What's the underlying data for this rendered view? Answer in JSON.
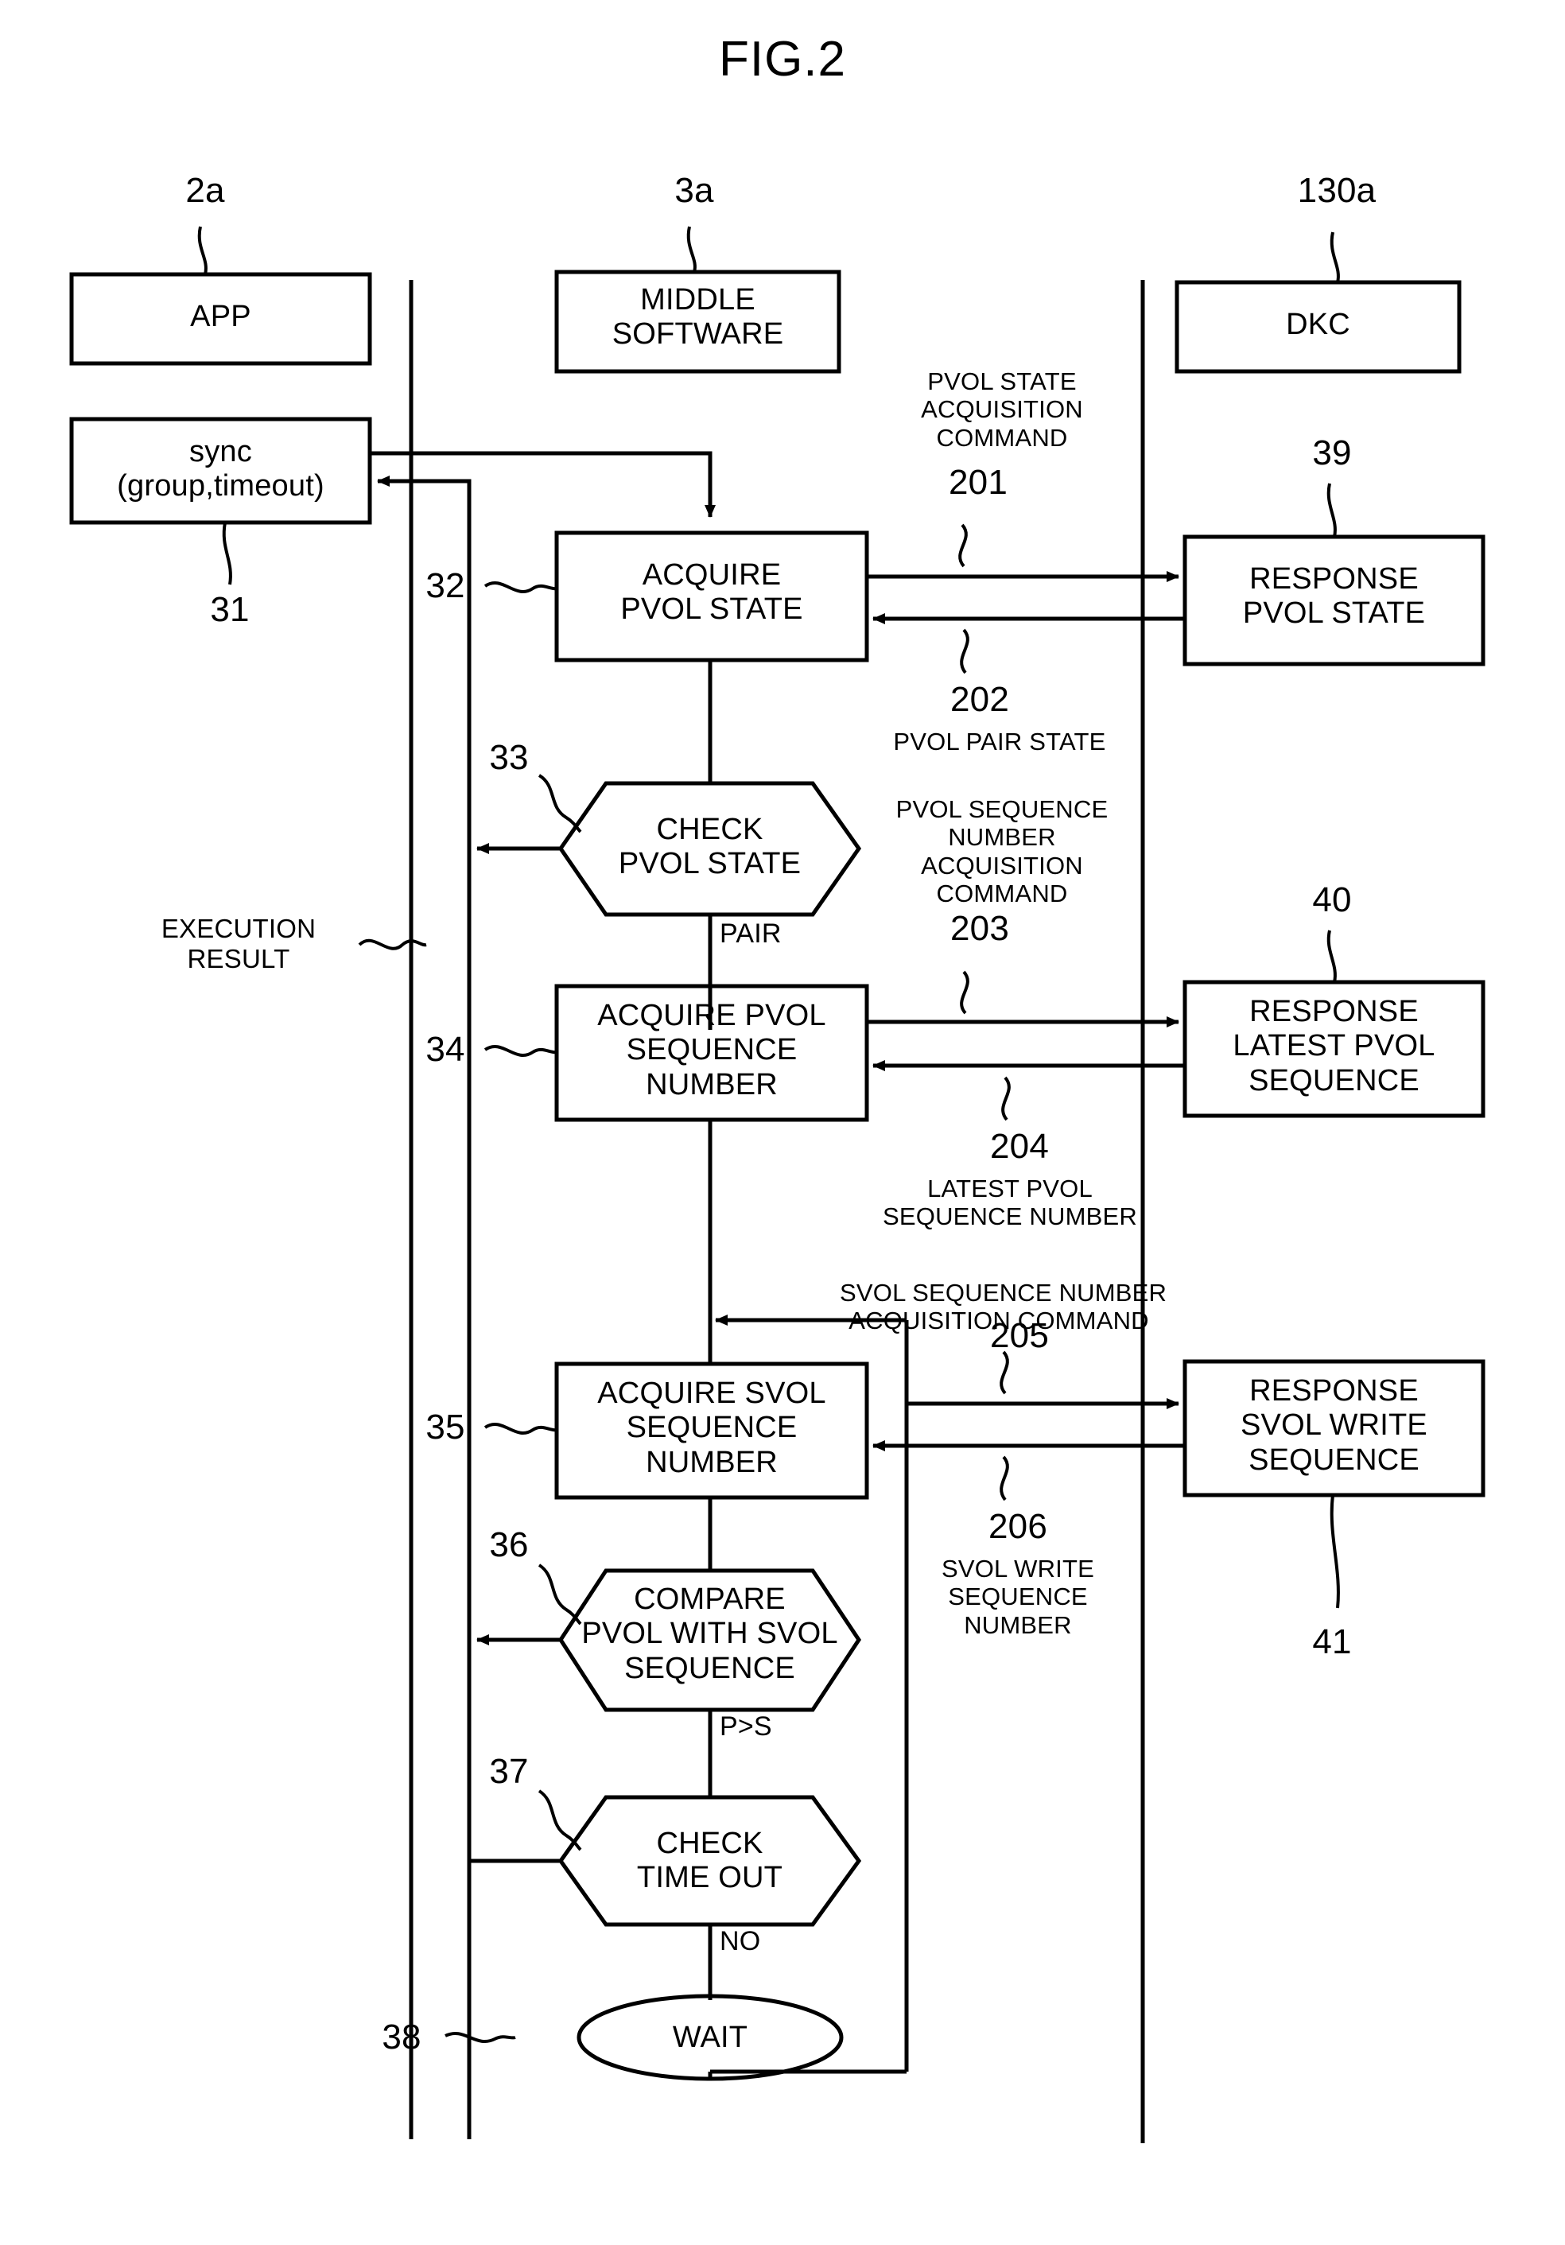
{
  "figure": {
    "title": "FIG.2",
    "type": "patent-flow-diagram"
  },
  "columns": [
    {
      "ref": "2a",
      "label": "APP"
    },
    {
      "ref": "3a",
      "label": "MIDDLE\nSOFTWARE"
    },
    {
      "ref": "130a",
      "label": "DKC"
    }
  ],
  "app_column": {
    "sync_box": {
      "ref": "31",
      "label": "sync\n(group,timeout)"
    },
    "execution_result_label": "EXECUTION\nRESULT"
  },
  "middleware_steps": [
    {
      "ref": "32",
      "shape": "rect",
      "label": "ACQUIRE\nPVOL STATE"
    },
    {
      "ref": "33",
      "shape": "hexagon",
      "label": "CHECK\nPVOL STATE",
      "exit": "PAIR"
    },
    {
      "ref": "34",
      "shape": "rect",
      "label": "ACQUIRE PVOL\nSEQUENCE\nNUMBER"
    },
    {
      "ref": "35",
      "shape": "rect",
      "label": "ACQUIRE SVOL\nSEQUENCE\nNUMBER"
    },
    {
      "ref": "36",
      "shape": "hexagon",
      "label": "COMPARE\nPVOL WITH SVOL\nSEQUENCE",
      "exit": "P>S"
    },
    {
      "ref": "37",
      "shape": "hexagon",
      "label": "CHECK\nTIME OUT",
      "exit": "NO"
    },
    {
      "ref": "38",
      "shape": "ellipse",
      "label": "WAIT"
    }
  ],
  "dkc_boxes": [
    {
      "ref": "39",
      "label": "RESPONSE\nPVOL STATE"
    },
    {
      "ref": "40",
      "label": "RESPONSE\nLATEST PVOL\nSEQUENCE"
    },
    {
      "ref": "41",
      "label": "RESPONSE\nSVOL WRITE\nSEQUENCE"
    }
  ],
  "messages": [
    {
      "ref": "201",
      "label": "PVOL STATE\nACQUISITION\nCOMMAND",
      "direction": "to-dkc"
    },
    {
      "ref": "202",
      "label": "PVOL PAIR STATE",
      "direction": "from-dkc"
    },
    {
      "ref": "203",
      "label": "PVOL SEQUENCE\nNUMBER\nACQUISITION\nCOMMAND",
      "direction": "to-dkc"
    },
    {
      "ref": "204",
      "label": "LATEST PVOL\nSEQUENCE NUMBER",
      "direction": "from-dkc"
    },
    {
      "ref": "205",
      "label": "SVOL SEQUENCE NUMBER\nACQUISITION COMMAND",
      "direction": "to-dkc"
    },
    {
      "ref": "206",
      "label": "SVOL WRITE\nSEQUENCE\nNUMBER",
      "direction": "from-dkc"
    }
  ],
  "colors": {
    "ink": "#000000",
    "paper": "#ffffff"
  }
}
